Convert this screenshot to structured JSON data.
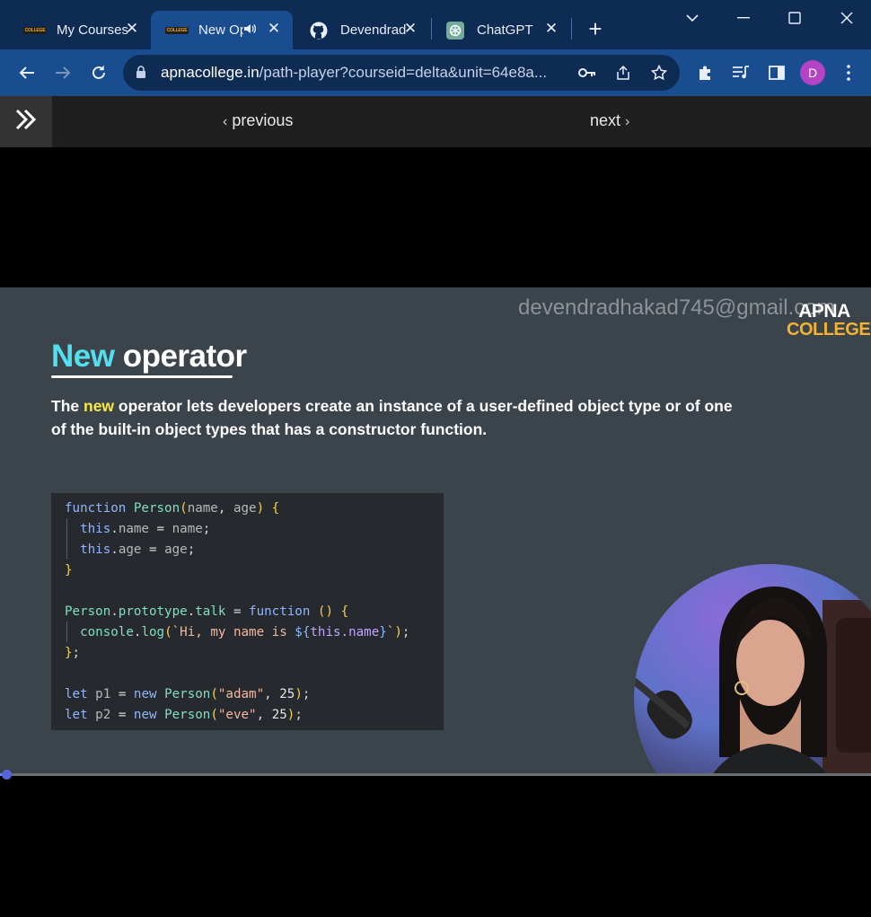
{
  "tabs": [
    {
      "title": "My Courses",
      "favicon": "apna-college-favicon"
    },
    {
      "title": "New Op",
      "favicon": "apna-college-favicon"
    },
    {
      "title": "Devendrad",
      "favicon": "github-icon"
    },
    {
      "title": "ChatGPT",
      "favicon": "chatgpt-icon"
    }
  ],
  "address_bar": {
    "host": "apnacollege.in",
    "path": "/path-player?courseid=delta&unit=64e8a..."
  },
  "profile_initial": "D",
  "player_nav": {
    "previous_label": "previous",
    "next_label": "next"
  },
  "slide": {
    "watermark": "devendradhakad745@gmail.com",
    "brand_line1": "APNA",
    "brand_line2": "COLLEGE",
    "title_highlight": "New",
    "title_rest": "operator",
    "desc_before": "The",
    "desc_keyword": "new",
    "desc_after": "operator lets developers create an instance of a user-defined object type or of one of the built-in object types that has a constructor function."
  },
  "code_lines": [
    "function Person(name, age) {",
    "  this.name = name;",
    "  this.age = age;",
    "}",
    "",
    "Person.prototype.talk = function () {",
    "  console.log(`Hi, my name is ${this.name}`);",
    "};",
    "",
    "let p1 = new Person(\"adam\", 25);",
    "let p2 = new Person(\"eve\", 25);"
  ],
  "video": {
    "progress_fraction": 0.005
  },
  "colors": {
    "tab_strip": "#0d2b53",
    "toolbar": "#1a4d8f",
    "slide_bg": "#3b434b",
    "title_highlight": "#52e0f0",
    "keyword_yellow": "#f6e94c",
    "brand_orange": "#f2b233"
  }
}
